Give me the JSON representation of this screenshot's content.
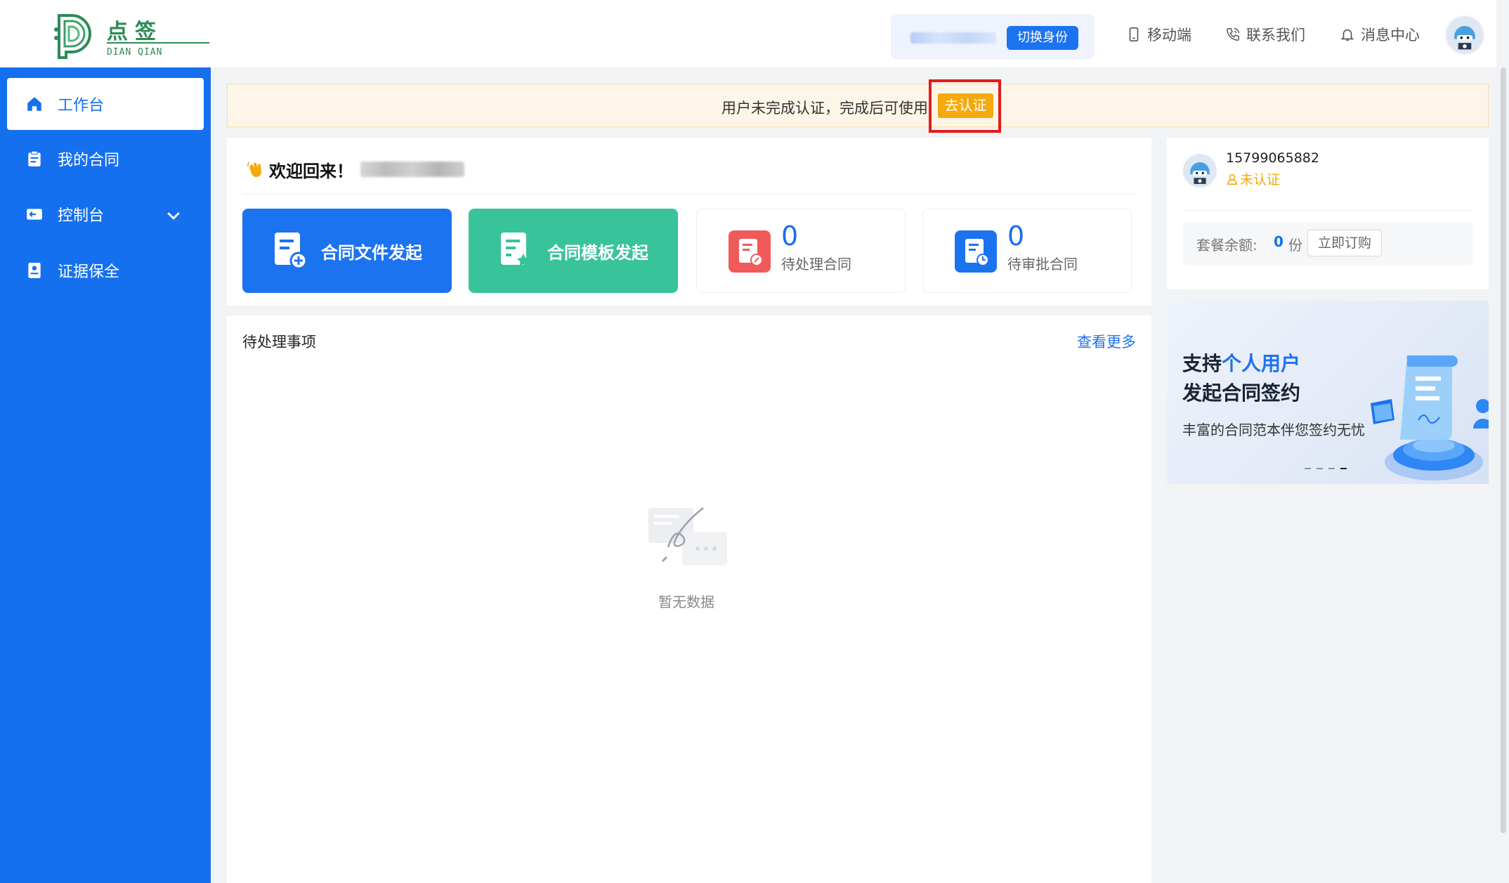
{
  "header": {
    "logo": {
      "cn": "点签",
      "en": "DIAN QIAN"
    },
    "switch_identity": "切换身份",
    "nav": {
      "mobile": "移动端",
      "contact": "联系我们",
      "messages": "消息中心"
    }
  },
  "sidebar": {
    "items": [
      {
        "label": "工作台",
        "icon": "home-icon",
        "active": true
      },
      {
        "label": "我的合同",
        "icon": "clipboard-icon"
      },
      {
        "label": "控制台",
        "icon": "console-icon",
        "expandable": true
      },
      {
        "label": "证据保全",
        "icon": "evidence-icon"
      }
    ]
  },
  "notice": {
    "text": "用户未完成认证，完成后可使用",
    "button": "去认证"
  },
  "welcome": {
    "title": "欢迎回来！",
    "actions": [
      {
        "label": "合同文件发起",
        "color": "#1c73f0"
      },
      {
        "label": "合同模板发起",
        "color": "#38c39a"
      }
    ],
    "stats": [
      {
        "value": "0",
        "label": "待处理合同",
        "color": "#f05a5a"
      },
      {
        "value": "0",
        "label": "待审批合同",
        "color": "#1c73f0"
      }
    ]
  },
  "pending": {
    "title": "待处理事项",
    "more": "查看更多",
    "empty": "暂无数据"
  },
  "profile": {
    "phone": "15799065882",
    "status": "未认证",
    "package_label": "套餐余额:",
    "package_value": "0",
    "package_unit": "份",
    "subscribe": "立即订购"
  },
  "banner": {
    "line1_pre": "支持",
    "line1_hl": "个人用户",
    "line2": "发起合同签约",
    "line3": "丰富的合同范本伴您签约无忧"
  },
  "colors": {
    "primary": "#1570ef",
    "warning": "#f4a90f",
    "highlight": "#e51b1b"
  }
}
